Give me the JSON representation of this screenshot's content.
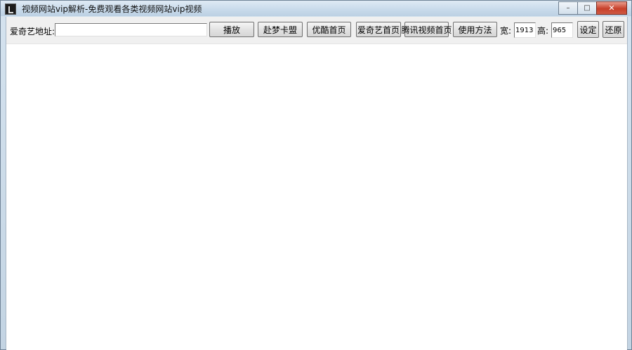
{
  "window": {
    "title": "视频网站vip解析-免费观看各类视频网站vip视频",
    "controls": {
      "minimize": "–",
      "maximize": "□",
      "close": "✕"
    }
  },
  "toolbar": {
    "url_label": "爱奇艺地址:",
    "url_value": "",
    "play_button": "播放",
    "buttons": [
      "赴梦卡盟",
      "优酷首页",
      "爱奇艺首页",
      "腾讯视频首页",
      "使用方法"
    ],
    "width_label": "宽:",
    "width_value": "1913",
    "height_label": "高:",
    "height_value": "965",
    "set_button": "设定",
    "restore_button": "还原"
  }
}
